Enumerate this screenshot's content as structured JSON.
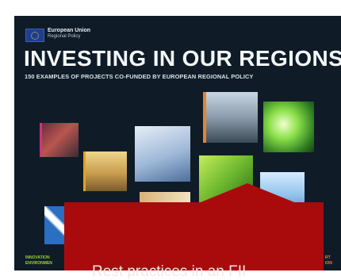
{
  "cover": {
    "org_line1": "European Union",
    "org_line2": "Regional Policy",
    "title": "INVESTING IN OUR REGIONS",
    "subtitle": "150 EXAMPLES OF PROJECTS CO-FUNDED BY EUROPEAN REGIONAL POLICY",
    "bottom_left_1": "INNOVATION",
    "bottom_left_2": "ENVIRONMEN",
    "bottom_right_1": "RT",
    "bottom_right_2": "ION"
  },
  "overlay": {
    "caption": "Rest practices in an FII"
  },
  "colors": {
    "cover_background": "#0f1c27",
    "overlay_red": "#a90b0d",
    "eu_blue": "#1e3f8f",
    "accent_green": "#9ccf3a",
    "accent_orange": "#e7832a"
  }
}
